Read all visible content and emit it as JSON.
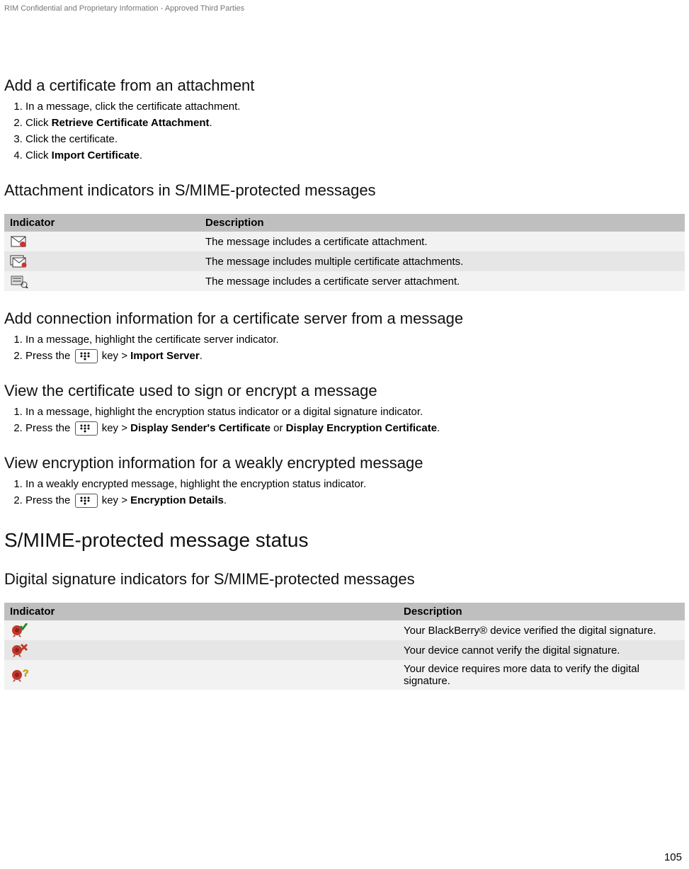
{
  "header": "RIM Confidential and Proprietary Information - Approved Third Parties",
  "page_number": "105",
  "section1": {
    "title": "Add a certificate from an attachment",
    "steps": {
      "s1": "In a message, click the certificate attachment.",
      "s2_pre": "Click ",
      "s2_bold": "Retrieve Certificate Attachment",
      "s2_post": ".",
      "s3": "Click the certificate.",
      "s4_pre": "Click ",
      "s4_bold": "Import Certificate",
      "s4_post": "."
    }
  },
  "section2": {
    "title": "Attachment indicators in S/MIME-protected messages",
    "table": {
      "h1": "Indicator",
      "h2": "Description",
      "r1_icon_name": "certificate-attachment-icon",
      "r1_desc": "The message includes a certificate attachment.",
      "r2_icon_name": "multiple-certificate-attachment-icon",
      "r2_desc": "The message includes multiple certificate attachments.",
      "r3_icon_name": "certificate-server-attachment-icon",
      "r3_desc": "The message includes a certificate server attachment."
    }
  },
  "section3": {
    "title": "Add connection information for a certificate server from a message",
    "steps": {
      "s1": "In a message, highlight the certificate server indicator.",
      "s2_pre": "Press the ",
      "s2_mid": " key > ",
      "s2_bold": "Import Server",
      "s2_post": "."
    }
  },
  "section4": {
    "title": "View the certificate used to sign or encrypt a message",
    "steps": {
      "s1": "In a message, highlight the encryption status indicator or a digital signature indicator.",
      "s2_pre": "Press the ",
      "s2_mid": " key > ",
      "s2_bold1": "Display Sender's Certificate",
      "s2_or": " or ",
      "s2_bold2": "Display Encryption Certificate",
      "s2_post": "."
    }
  },
  "section5": {
    "title": "View encryption information for a weakly encrypted message",
    "steps": {
      "s1": "In a weakly encrypted message, highlight the encryption status indicator.",
      "s2_pre": "Press the ",
      "s2_mid": " key > ",
      "s2_bold": "Encryption Details",
      "s2_post": "."
    }
  },
  "majorsection": {
    "title": "S/MIME-protected message status"
  },
  "section6": {
    "title": "Digital signature indicators for S/MIME-protected messages",
    "table": {
      "h1": "Indicator",
      "h2": "Description",
      "r1_icon_name": "signature-verified-icon",
      "r1_desc": "Your BlackBerry® device verified the digital signature.",
      "r2_icon_name": "signature-not-verified-icon",
      "r2_desc": "Your device cannot verify the digital signature.",
      "r3_icon_name": "signature-more-data-icon",
      "r3_desc": "Your device requires more data to verify the digital signature."
    }
  }
}
